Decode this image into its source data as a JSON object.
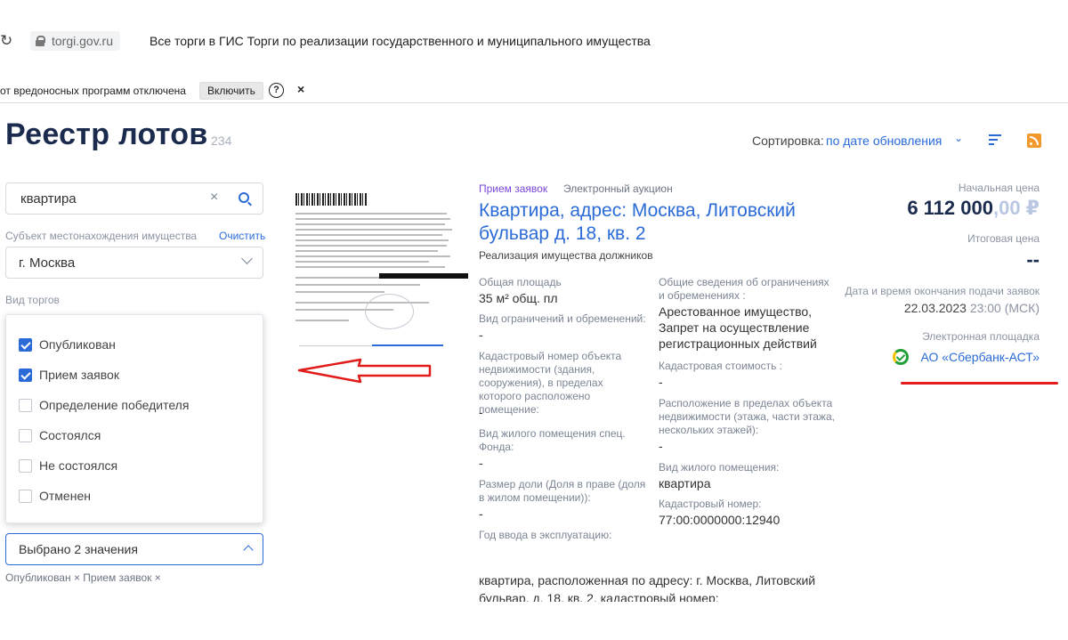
{
  "browser": {
    "url": "torgi.gov.ru",
    "page_title": "Все торги в ГИС Торги по реализации государственного и муниципального имущества",
    "warning_text": "от вредоносных программ отключена",
    "enable_button": "Включить",
    "help_glyph": "?",
    "close_glyph": "×"
  },
  "header": {
    "title": "Реестр лотов",
    "count": "234",
    "sort_label": "Сортировка:",
    "sort_value": "по дате обновления"
  },
  "filters": {
    "search_value": "квартира",
    "clear_glyph": "×",
    "subject_label": "Субъект местонахождения имущества",
    "clear_link": "Очистить",
    "region_value": "г. Москва",
    "trade_type_label": "Вид торгов",
    "status_options": [
      {
        "label": "Опубликован",
        "checked": true
      },
      {
        "label": "Прием заявок",
        "checked": true
      },
      {
        "label": "Определение победителя",
        "checked": false
      },
      {
        "label": "Состоялся",
        "checked": false
      },
      {
        "label": "Не состоялся",
        "checked": false
      },
      {
        "label": "Отменен",
        "checked": false
      }
    ],
    "status_select_value": "Выбрано 2 значения",
    "selected_chips": "Опубликован × Прием заявок ×"
  },
  "lot": {
    "status": "Прием заявок",
    "auction_type": "Электронный аукцион",
    "title": "Квартира, адрес: Москва, Литовский бульвар д. 18, кв. 2",
    "subtitle": "Реализация имущества должников",
    "left_fields": [
      {
        "label": "Общая площадь",
        "value": "35 м² общ. пл"
      },
      {
        "label": "Вид ограничений и обременений:",
        "value": "-"
      },
      {
        "label": "Кадастровый номер объекта недвижимости (здания, сооружения), в пределах которого расположено помещение:",
        "value": "-"
      },
      {
        "label": "Вид жилого помещения спец. Фонда:",
        "value": "-"
      },
      {
        "label": "Размер доли (Доля в праве (доля в жилом помещении)):",
        "value": "-"
      },
      {
        "label": "Год ввода в эксплуатацию:",
        "value": ""
      }
    ],
    "right_fields": [
      {
        "label": "Общие сведения об ограничениях и обременениях :",
        "value": "Арестованное имущество, Запрет на осуществление регистрационных действий"
      },
      {
        "label": "Кадастровая стоимость :",
        "value": "-"
      },
      {
        "label": "Расположение в пределах объекта недвижимости (этажа, части этажа, нескольких этажей):",
        "value": "-"
      },
      {
        "label": "Вид жилого помещения:",
        "value": "квартира"
      },
      {
        "label": "Кадастровый номер:",
        "value": "77:00:0000000:12940"
      }
    ],
    "description": "квартира, расположенная по адресу: г. Москва, Литовский бульвар, д. 18, кв. 2, кадастровый номер:"
  },
  "pricing": {
    "start_price_label": "Начальная цена",
    "start_price_main": "6 112 000",
    "start_price_decimal": ",00 ₽",
    "final_price_label": "Итоговая цена",
    "final_price": "--",
    "deadline_label": "Дата и время окончания подачи заявок",
    "deadline_date": "22.03.2023",
    "deadline_time": "23:00 (МСК)",
    "platform_label": "Электронная площадка",
    "platform_name": "АО «Сбербанк-АСТ»"
  },
  "colors": {
    "accent": "#2a6bd8",
    "title": "#1b2b4d",
    "status_purple": "#7a46d9",
    "annotation_red": "#e21b1b"
  },
  "icons": [
    "reload-icon",
    "lock-icon",
    "help-icon",
    "close-icon",
    "search-icon",
    "chevron-down-icon",
    "chevron-up-icon",
    "filter-lines-icon",
    "rss-icon",
    "sber-logo-icon",
    "checkbox-icon"
  ]
}
